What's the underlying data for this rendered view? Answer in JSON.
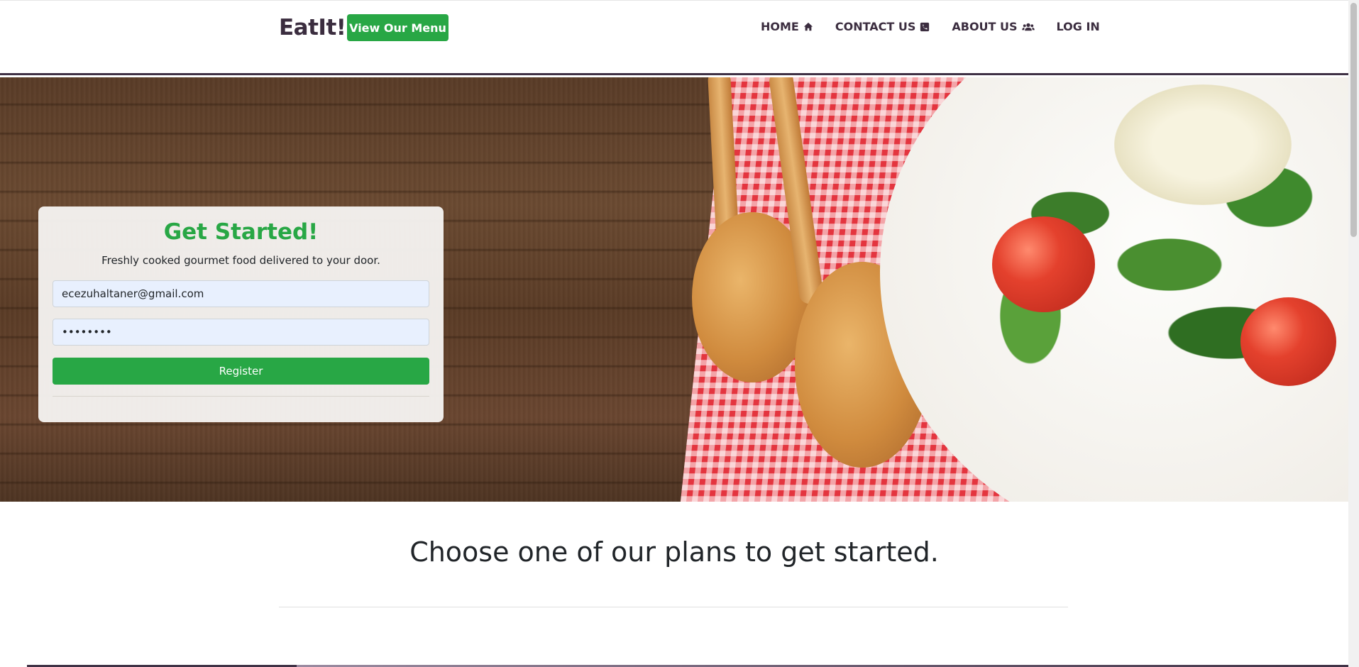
{
  "navbar": {
    "brand": "EatIt!",
    "menu_button": "View Our Menu",
    "links": [
      {
        "label": "HOME",
        "icon": "home-icon"
      },
      {
        "label": "CONTACT US",
        "icon": "phone-icon"
      },
      {
        "label": "ABOUT US",
        "icon": "users-icon"
      },
      {
        "label": "LOG IN",
        "icon": ""
      }
    ]
  },
  "signup": {
    "title": "Get Started!",
    "subtitle": "Freshly cooked gourmet food delivered to your door.",
    "email_value": "ecezuhaltaner@gmail.com",
    "password_value": "••••••••",
    "register_label": "Register"
  },
  "plans": {
    "heading": "Choose one of our plans to get started."
  },
  "colors": {
    "accent": "#28a745",
    "brand_text": "#3b2d3f",
    "input_bg": "#e8f0fe"
  }
}
